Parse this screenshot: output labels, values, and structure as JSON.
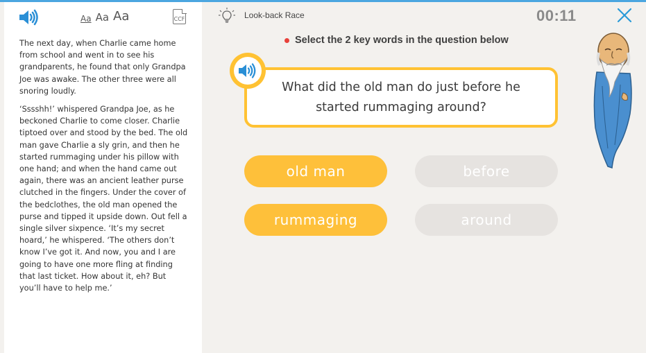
{
  "sidebar": {
    "font_sizes": [
      "Aa",
      "Aa",
      "Aa"
    ],
    "ccf_label": "CCF",
    "story_paragraphs": [
      "The next day, when Charlie came home from school and went in to see his grandparents, he found that only Grandpa Joe was awake. The other three were all snoring loudly.",
      "‘Sssshh!’ whispered Grandpa Joe, as he beckoned Charlie to come closer. Charlie tiptoed over and stood by the bed. The old man gave Charlie a sly grin, and then he started rummaging under his pillow with one hand; and when the hand came out again, there was an ancient leather purse clutched in the fingers. Under the cover of the bedclothes, the old man opened the purse and tipped it upside down. Out fell a single silver sixpence. ‘It’s my secret hoard,’ he whispered. ‘The others don’t know I’ve got it. And now, you and I are going to have one more fling at finding that last ticket. How about it, eh? But you’ll have to help me.’"
    ]
  },
  "header": {
    "game_title": "Look-back Race",
    "timer": "00:11"
  },
  "instruction": "Select the 2 key words in the question below",
  "question": "What did the old man do just before he started rummaging around?",
  "words": [
    {
      "label": "old man",
      "selected": true
    },
    {
      "label": "before",
      "selected": false
    },
    {
      "label": "rummaging",
      "selected": true
    },
    {
      "label": "around",
      "selected": false
    }
  ],
  "colors": {
    "accent": "#ffc233",
    "selected_word": "#fec03a",
    "unselected_word": "#e6e3e0",
    "speaker_blue": "#2a8fd6",
    "instruction_dot": "#e8413a"
  },
  "icons": [
    "speaker-icon",
    "bulb-icon",
    "close-icon",
    "ccf-icon"
  ]
}
